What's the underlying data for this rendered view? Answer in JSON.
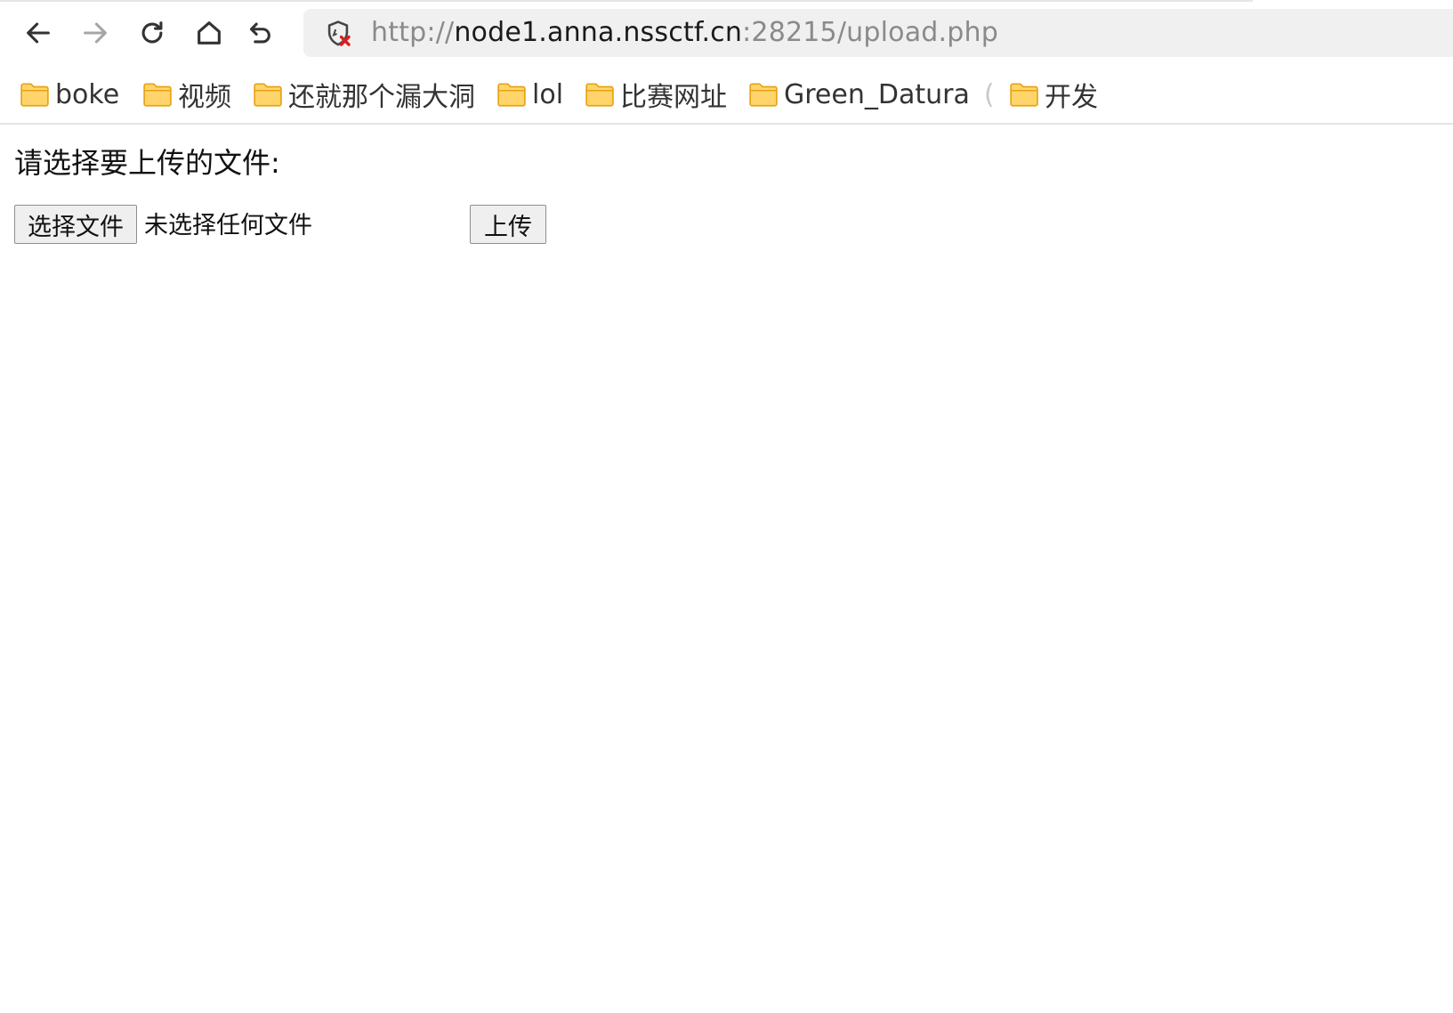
{
  "browser": {
    "nav": {
      "back_icon": "arrow-left-icon",
      "forward_icon": "arrow-right-icon",
      "reload_icon": "reload-icon",
      "home_icon": "home-icon",
      "undo_icon": "undo-icon"
    },
    "address_bar": {
      "security_icon": "shield-insecure-icon",
      "scheme": "http://",
      "host": "node1.anna.nssctf.cn",
      "rest": ":28215/upload.php"
    },
    "bookmarks": [
      {
        "label": "boke"
      },
      {
        "label": "视频"
      },
      {
        "label": "还就那个漏大洞"
      },
      {
        "label": "lol"
      },
      {
        "label": "比赛网址"
      },
      {
        "label": "Green_Datura",
        "trail": "("
      },
      {
        "label": "开发"
      }
    ],
    "folder_color": "#f6b93b"
  },
  "page": {
    "prompt": "请选择要上传的文件:",
    "choose_file_button": "选择文件",
    "file_status": "未选择任何文件",
    "upload_button": "上传"
  }
}
